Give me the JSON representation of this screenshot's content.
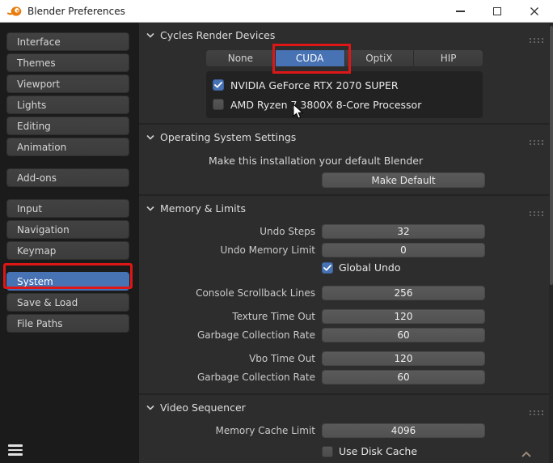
{
  "window": {
    "title": "Blender Preferences"
  },
  "sidebar": {
    "groups": [
      {
        "items": [
          "Interface",
          "Themes",
          "Viewport",
          "Lights",
          "Editing",
          "Animation"
        ]
      },
      {
        "items": [
          "Add-ons"
        ]
      },
      {
        "items": [
          "Input",
          "Navigation",
          "Keymap"
        ]
      },
      {
        "items": [
          "System",
          "Save & Load",
          "File Paths"
        ]
      }
    ],
    "selected_item": "System"
  },
  "main": {
    "cycles": {
      "title": "Cycles Render Devices",
      "tabs": [
        {
          "label": "None",
          "selected": false
        },
        {
          "label": "CUDA",
          "selected": true,
          "annotated": true
        },
        {
          "label": "OptiX",
          "selected": false
        },
        {
          "label": "HIP",
          "selected": false
        }
      ],
      "devices": [
        {
          "label": "NVIDIA GeForce RTX 2070 SUPER",
          "checked": true
        },
        {
          "label": "AMD Ryzen 7 3800X 8-Core Processor",
          "checked": false
        }
      ]
    },
    "os": {
      "title": "Operating System Settings",
      "description": "Make this installation your default Blender",
      "button_label": "Make Default"
    },
    "memory": {
      "title": "Memory & Limits",
      "rows": [
        {
          "label": "Undo Steps",
          "value": "32"
        },
        {
          "label": "Undo Memory Limit",
          "value": "0"
        },
        {
          "label": "Console Scrollback Lines",
          "value": "256"
        },
        {
          "label": "Texture Time Out",
          "value": "120"
        },
        {
          "label": "Garbage Collection Rate",
          "value": "60"
        },
        {
          "label": "Vbo Time Out",
          "value": "120"
        },
        {
          "label": "Garbage Collection Rate",
          "value": "60"
        }
      ],
      "global_undo_label": "Global Undo",
      "global_undo_checked": true
    },
    "video": {
      "title": "Video Sequencer",
      "cache_label": "Memory Cache Limit",
      "cache_value": "4096",
      "disk_label": "Use Disk Cache",
      "disk_checked": false
    }
  },
  "colors": {
    "accent_blue": "#4772b3",
    "annotation_red": "#de1616",
    "titlebar_bg": "#ffffff",
    "sidebar_bg": "#1b1b1b",
    "main_bg": "#2d2d2d",
    "panel_dark": "#222222",
    "field_gray": "#545454",
    "logo_orange": "#e87d0d"
  }
}
